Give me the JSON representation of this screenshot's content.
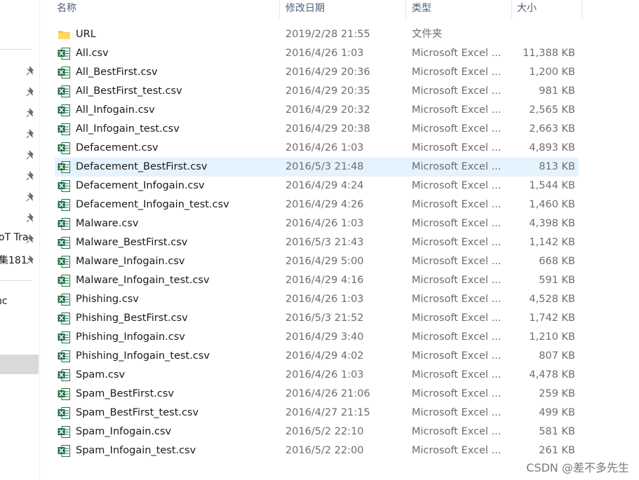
{
  "columns": {
    "name": "名称",
    "date": "修改日期",
    "type": "类型",
    "size": "大小"
  },
  "nav": {
    "text_1": "oT Tra",
    "text_2": "集181",
    "text_3": "nc"
  },
  "files": [
    {
      "name": "URL",
      "date": "2019/2/28 21:55",
      "type": "文件夹",
      "size": "",
      "icon": "folder-icon"
    },
    {
      "name": "All.csv",
      "date": "2016/4/26 1:03",
      "type": "Microsoft Excel ...",
      "size": "11,388 KB",
      "icon": "excel-icon"
    },
    {
      "name": "All_BestFirst.csv",
      "date": "2016/4/29 20:36",
      "type": "Microsoft Excel ...",
      "size": "1,200 KB",
      "icon": "excel-icon"
    },
    {
      "name": "All_BestFirst_test.csv",
      "date": "2016/4/29 20:35",
      "type": "Microsoft Excel ...",
      "size": "981 KB",
      "icon": "excel-icon"
    },
    {
      "name": "All_Infogain.csv",
      "date": "2016/4/29 20:32",
      "type": "Microsoft Excel ...",
      "size": "2,565 KB",
      "icon": "excel-icon"
    },
    {
      "name": "All_Infogain_test.csv",
      "date": "2016/4/29 20:38",
      "type": "Microsoft Excel ...",
      "size": "2,663 KB",
      "icon": "excel-icon"
    },
    {
      "name": "Defacement.csv",
      "date": "2016/4/26 1:03",
      "type": "Microsoft Excel ...",
      "size": "4,893 KB",
      "icon": "excel-icon"
    },
    {
      "name": "Defacement_BestFirst.csv",
      "date": "2016/5/3 21:48",
      "type": "Microsoft Excel ...",
      "size": "813 KB",
      "icon": "excel-icon",
      "selected": true
    },
    {
      "name": "Defacement_Infogain.csv",
      "date": "2016/4/29 4:24",
      "type": "Microsoft Excel ...",
      "size": "1,544 KB",
      "icon": "excel-icon"
    },
    {
      "name": "Defacement_Infogain_test.csv",
      "date": "2016/4/29 4:26",
      "type": "Microsoft Excel ...",
      "size": "1,460 KB",
      "icon": "excel-icon"
    },
    {
      "name": "Malware.csv",
      "date": "2016/4/26 1:03",
      "type": "Microsoft Excel ...",
      "size": "4,398 KB",
      "icon": "excel-icon"
    },
    {
      "name": "Malware_BestFirst.csv",
      "date": "2016/5/3 21:43",
      "type": "Microsoft Excel ...",
      "size": "1,142 KB",
      "icon": "excel-icon"
    },
    {
      "name": "Malware_Infogain.csv",
      "date": "2016/4/29 5:00",
      "type": "Microsoft Excel ...",
      "size": "668 KB",
      "icon": "excel-icon"
    },
    {
      "name": "Malware_Infogain_test.csv",
      "date": "2016/4/29 4:16",
      "type": "Microsoft Excel ...",
      "size": "591 KB",
      "icon": "excel-icon"
    },
    {
      "name": "Phishing.csv",
      "date": "2016/4/26 1:03",
      "type": "Microsoft Excel ...",
      "size": "4,528 KB",
      "icon": "excel-icon"
    },
    {
      "name": "Phishing_BestFirst.csv",
      "date": "2016/5/3 21:52",
      "type": "Microsoft Excel ...",
      "size": "1,742 KB",
      "icon": "excel-icon"
    },
    {
      "name": "Phishing_Infogain.csv",
      "date": "2016/4/29 3:40",
      "type": "Microsoft Excel ...",
      "size": "1,210 KB",
      "icon": "excel-icon"
    },
    {
      "name": "Phishing_Infogain_test.csv",
      "date": "2016/4/29 4:02",
      "type": "Microsoft Excel ...",
      "size": "807 KB",
      "icon": "excel-icon"
    },
    {
      "name": "Spam.csv",
      "date": "2016/4/26 1:03",
      "type": "Microsoft Excel ...",
      "size": "4,478 KB",
      "icon": "excel-icon"
    },
    {
      "name": "Spam_BestFirst.csv",
      "date": "2016/4/26 21:06",
      "type": "Microsoft Excel ...",
      "size": "259 KB",
      "icon": "excel-icon"
    },
    {
      "name": "Spam_BestFirst_test.csv",
      "date": "2016/4/27 21:15",
      "type": "Microsoft Excel ...",
      "size": "499 KB",
      "icon": "excel-icon"
    },
    {
      "name": "Spam_Infogain.csv",
      "date": "2016/5/2 22:10",
      "type": "Microsoft Excel ...",
      "size": "581 KB",
      "icon": "excel-icon"
    },
    {
      "name": "Spam_Infogain_test.csv",
      "date": "2016/5/2 22:00",
      "type": "Microsoft Excel ...",
      "size": "261 KB",
      "icon": "excel-icon"
    }
  ],
  "watermark": "CSDN @差不多先生",
  "colors": {
    "selected_row": "#e5f3ff",
    "header_text": "#4c607a",
    "excel_green": "#1d7044",
    "folder_yellow": "#f7c948"
  }
}
